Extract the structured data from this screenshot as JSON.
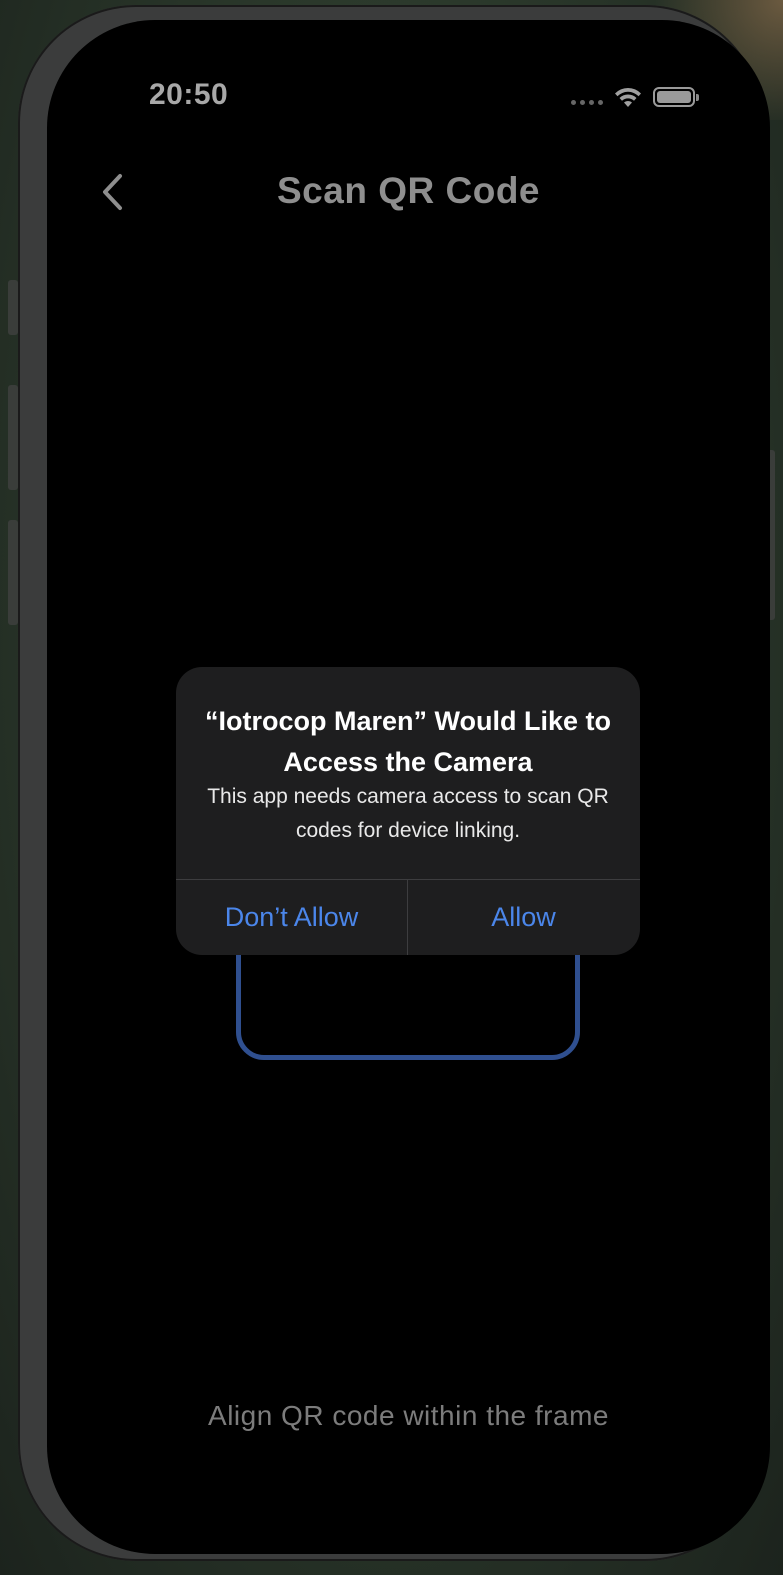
{
  "status_bar": {
    "time": "20:50"
  },
  "nav": {
    "title": "Scan QR Code",
    "back_icon": "chevron-left-icon"
  },
  "scanner": {
    "hint": "Align QR code within the frame",
    "frame_color": "#2f4f8f"
  },
  "alert": {
    "title": "“Iotrocop Maren” Would Like to Access the Camera",
    "message": "This app needs camera access to scan QR codes for device linking.",
    "deny_label": "Don’t Allow",
    "allow_label": "Allow",
    "button_color": "#4b86ea"
  }
}
